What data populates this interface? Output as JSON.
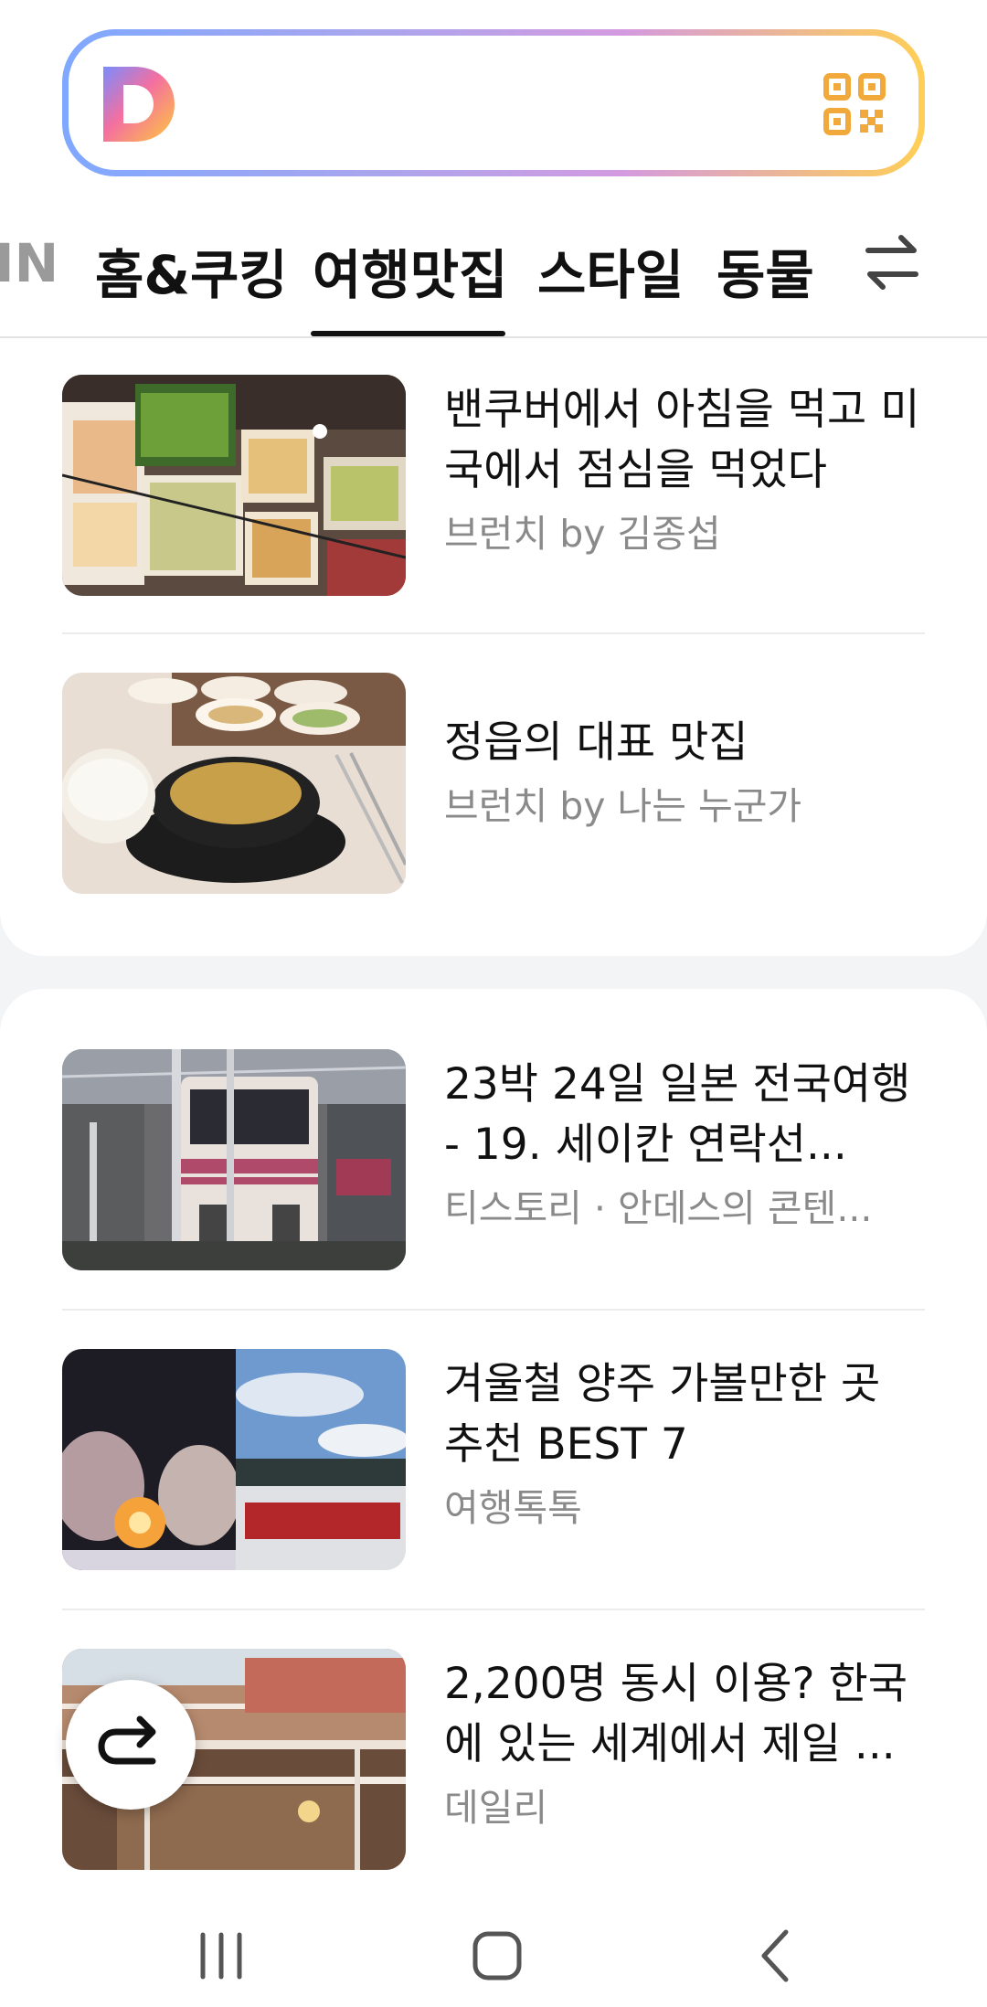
{
  "tabs": [
    {
      "label": "IN",
      "active": false
    },
    {
      "label": "홈&쿠킹",
      "active": false
    },
    {
      "label": "여행맛집",
      "active": true
    },
    {
      "label": "스타일",
      "active": false
    },
    {
      "label": "동물",
      "active": false
    }
  ],
  "articles": [
    {
      "title": "밴쿠버에서 아침을 먹고 미국에서 점심을 먹었다",
      "meta": "브런치 by 김종섭"
    },
    {
      "title": "정읍의 대표 맛집",
      "meta": "브런치 by 나는 누군가"
    },
    {
      "title": "23박 24일 일본 전국여행 - 19. 세이칸 연락선...",
      "meta": "티스토리 · 안데스의 콘텐..."
    },
    {
      "title": "겨울철 양주 가볼만한 곳 추천 BEST 7",
      "meta": "여행톡톡"
    },
    {
      "title": "2,200명 동시 이용? 한국에 있는 세계에서 제일 ...",
      "meta": "데일리"
    }
  ],
  "colors": {
    "accent_gradient": [
      "#7fa8ff",
      "#d49ae0",
      "#ffcf55"
    ],
    "qr": "#f2a93b",
    "tab_active": "#111111"
  },
  "icons": [
    "daum-logo-icon",
    "qr-code-icon",
    "swap-arrows-icon",
    "share-icon",
    "recent-apps-icon",
    "home-icon",
    "back-icon"
  ]
}
